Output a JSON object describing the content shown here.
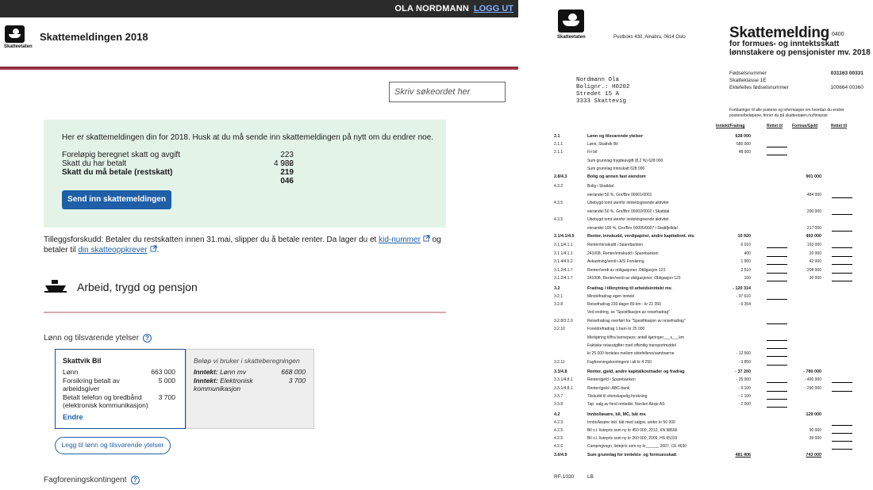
{
  "web": {
    "topbar": {
      "user": "OLA NORDMANN",
      "logout": "LOGG UT"
    },
    "logo_text": "Skatteetaten",
    "title": "Skattemeldingen 2018",
    "search_placeholder": "Skriv søkeordet her",
    "info": {
      "message": "Her er skattemeldingen din for 2018. Husk at du må sende inn skattemeldingen på nytt om du endrer noe.",
      "rows": [
        {
          "label": "Foreløpig beregnet skatt og avgift",
          "value": "223 982"
        },
        {
          "label": "Skatt du har betalt",
          "value": "4 936"
        },
        {
          "label": "Skatt du må betale (restskatt)",
          "value": "219 046"
        }
      ],
      "send_button": "Send inn skattemeldingen"
    },
    "note": {
      "pre": "Tilleggsforskudd: Betaler du restskatten innen 31.mai, slipper du å betale renter. Da lager du et ",
      "link1": "kid-nummer",
      "mid": " og betaler til ",
      "link2": "din skatteoppkrever",
      "post": "."
    },
    "section_title": "Arbeid, trygd og pensjon",
    "subsection1": "Lønn og tilsvarende ytelser",
    "card": {
      "title": "Skattvik Bil",
      "rows": [
        {
          "label": "Lønn",
          "value": "663 000"
        },
        {
          "label": "Forsikring betalt av arbeidsgiver",
          "value": "5 000"
        },
        {
          "label": "Betalt telefon og bredbånd (elektronisk kommunikasjon)",
          "value": "3 700"
        }
      ],
      "edit": "Endre"
    },
    "card2": {
      "header": "Beløp vi bruker i skatteberegningen",
      "rows": [
        {
          "label_bold": "Inntekt:",
          "label": " Lønn mv",
          "value": "668 000"
        },
        {
          "label_bold": "Inntekt:",
          "label": " Elektronisk kommunikasjon",
          "value": "3 700"
        }
      ]
    },
    "add_button": "Legg til lønn og tilsvarende ytelser",
    "subsection2": "Fagforeningskontingent",
    "help_glyph": "?"
  },
  "paper": {
    "logo_text": "Skatteetaten",
    "address": "Postboks 430, Alnabru, 0614 Oslo",
    "title": "Skattemelding",
    "form_no": "0400",
    "subtitle1": "for formues- og inntektsskatt",
    "subtitle2": "lønnstakere og pensjonister mv. 2018",
    "recipient": [
      "Nordmann Ola",
      "Bolignr.: H0202",
      "Stredet 15 A",
      "3333 Skattevig"
    ],
    "meta": [
      {
        "label": "Fødselsnummer",
        "value": "031163 00331"
      },
      {
        "label": "Skatteklasse 1E",
        "value": ""
      },
      {
        "label": "Ektefelles fødselsnummer",
        "value": "100664 00360"
      }
    ],
    "explanation": "Forklaringer til alle postene og informasjon om hvordan du endrer postene/beløpene, finner du på skatteetaten.no/finnpost",
    "col_headers": [
      "Inntekt/Fradrag",
      "Rettet til",
      "Formue/Gjeld",
      "Rettet til"
    ],
    "rows": [
      {
        "code": "2.1",
        "label": "Lønn og tilsvarende ytelser",
        "income": "628 000",
        "wealth": "",
        "h": true,
        "b1": false,
        "b2": false
      },
      {
        "code": "2.1.1",
        "label": "Lønn, Skattvik Bil",
        "income": "580 000",
        "wealth": "",
        "b1": true
      },
      {
        "code": "2.1.1",
        "label": "Fri bil",
        "income": "48 000",
        "wealth": "",
        "b1": true
      },
      {
        "code": "",
        "label": "Sum grunnlag trygdeavgift (8,2 %)   628 000",
        "income": "",
        "wealth": ""
      },
      {
        "code": "",
        "label": "Sum grunnlag trinnskatt  628 000",
        "income": "",
        "wealth": ""
      },
      {
        "code": "2.8/4.3",
        "label": "Bolig og annen fast eiendom",
        "income": "",
        "wealth": "901 000",
        "h": true
      },
      {
        "code": "4.3.2",
        "label": "Bolig i Skattdal",
        "income": "",
        "wealth": ""
      },
      {
        "code": "",
        "label": "eierandel 50 %, Gnr/Bnr 00001/0001",
        "income": "",
        "wealth": "484 000",
        "b2": true
      },
      {
        "code": "4.3.5",
        "label": "Ubebygd tomt utenfor inntektsgivende aktivitet",
        "income": "",
        "wealth": ""
      },
      {
        "code": "",
        "label": "eierandel 50 %, Gnr/Bnr 00002/0002 i Skattdal",
        "income": "",
        "wealth": "200 000",
        "b2": true
      },
      {
        "code": "4.3.5",
        "label": "Ubebygd tomt utenfor inntektsgivende aktivitet",
        "income": "",
        "wealth": ""
      },
      {
        "code": "",
        "label": "eierandel 100 %, Gnr/Bnr 00005/0007 i Skattfjelldal",
        "income": "",
        "wealth": "217 000",
        "b2": true
      },
      {
        "code": "3.1/4.1/4.5",
        "label": "Renter, innskudd, verdipapirer, andre kapitalinnt. mv.",
        "income": "10 920",
        "wealth": "493 000",
        "h": true
      },
      {
        "code": "3.1.1/4.1.1",
        "label": "Renter/innskudd i Sparebanken",
        "income": "6 010",
        "wealth": "193 000",
        "b1": true,
        "b2": true
      },
      {
        "code": "3.1.1/4.1.1",
        "label": "241008, Renter/innskudd i Sparebanken",
        "income": "400",
        "wealth": "20 000",
        "b1": true,
        "b2": true
      },
      {
        "code": "3.1.4/4.5.2",
        "label": "Avkastning/verdi i A/S Forsikring",
        "income": "1 900",
        "wealth": "42 000",
        "b1": true,
        "b2": true
      },
      {
        "code": "3.1.2/4.1.7",
        "label": "Renter/verdi av obligasjoner, Obligasjon 123",
        "income": "2 510",
        "wealth": "208 000",
        "b1": true,
        "b2": true
      },
      {
        "code": "3.1.2/4.1.7",
        "label": "241008, Renter/verdi av obligasjoner, Obligasjon 123",
        "income": "100",
        "wealth": "30 000",
        "b1": true,
        "b2": true
      },
      {
        "code": "3.2",
        "label": "Fradrag i tilknytning til arbeidsinntekt mv.",
        "income": "- 120 314",
        "wealth": "",
        "h": true
      },
      {
        "code": "3.2.1",
        "label": "Minstefradrag egen inntekt",
        "income": "- 97 610",
        "wealth": "",
        "b1": true
      },
      {
        "code": "3.2.8",
        "label": "Reisefradrag 230 dager 80 km - kr 22 350",
        "income": "- 6 354",
        "wealth": ""
      },
      {
        "code": "",
        "label": "Ved endring, se \"Spesifikasjon av reisefradrag\"",
        "income": "",
        "wealth": ""
      },
      {
        "code": "3.2.8/3.2.9",
        "label": "Reisefradrag overført fra \"Spesifikasjon av reisefradrag\"",
        "income": "",
        "wealth": "",
        "b1": true
      },
      {
        "code": "3.2.10",
        "label": "Foreldrefradrag 1 barn kr 25 000",
        "income": "",
        "wealth": ""
      },
      {
        "code": "",
        "label": "Merkjøring til/fra barnepass: antall kjøringer___x___km",
        "income": "",
        "wealth": "",
        "b1": true
      },
      {
        "code": "",
        "label": "Faktiske reiseutgifter med offentlig transportmiddel",
        "income": "",
        "wealth": "",
        "b1": true
      },
      {
        "code": "",
        "label": "kr 25 000 fordeles mellom ektefellene/samboerne",
        "income": "- 12 500",
        "wealth": "",
        "b1": true
      },
      {
        "code": "3.2.11",
        "label": "Fagforeningskontingent i alt kr 4 250",
        "income": "- 3 850",
        "wealth": "",
        "b1": true
      },
      {
        "code": "3.3/4.8",
        "label": "Renter, gjeld, andre kapitalkostnader og fradrag",
        "income": "- 37 200",
        "wealth": "- 780 000",
        "h": true
      },
      {
        "code": "3.3.1/4.8.1",
        "label": "Renter/gjeld i Sparebanken",
        "income": "- 25 000",
        "wealth": "- 490 000",
        "b1": true,
        "b2": true
      },
      {
        "code": "3.3.1/4.8.1",
        "label": "Renter/gjeld i ABC-bank",
        "income": "- 9 100",
        "wealth": "- 290 000",
        "b1": true,
        "b2": true
      },
      {
        "code": "3.3.7",
        "label": "Tilskudd til vitenskapelig forskning",
        "income": "- 1 100",
        "wealth": "",
        "b1": true
      },
      {
        "code": "3.3.8",
        "label": "Tap: salg av fond rentedel, Norden Aksje AS",
        "income": "- 2 000",
        "wealth": "",
        "b1": true
      },
      {
        "code": "4.2",
        "label": "Innbo/løsøre, bil, MC, båt mv.",
        "income": "",
        "wealth": "129 000",
        "h": true
      },
      {
        "code": "4.2.3",
        "label": "Innbo/løsøre inkl. båt med salgsv. under kr 50 000",
        "income": "",
        "wealth": "",
        "b2": true
      },
      {
        "code": "4.2.5",
        "label": "Bil o.l. listepris som ny kr 450 000, 2012, XN 98666",
        "income": "",
        "wealth": "90 000",
        "b2": true
      },
      {
        "code": "4.2.5",
        "label": "Bil o.l. listepris som ny kr 260 000, 2009, HS 65333",
        "income": "",
        "wealth": "39 000",
        "b2": true
      },
      {
        "code": "4.2.6",
        "label": "Campingvogn, listepris som ny kr______ 2007, CE 4630",
        "income": "",
        "wealth": "",
        "b2": true
      },
      {
        "code": "3.6/4.9",
        "label": "Sum grunnlag for inntekts- og formuesskatt",
        "income": "481 406",
        "wealth": "743 000",
        "h": true,
        "u": true
      }
    ],
    "footer_code": "RF-1030",
    "footer_lang": "LB"
  }
}
